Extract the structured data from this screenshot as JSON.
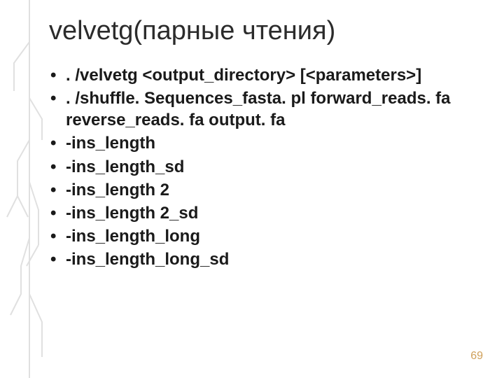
{
  "title": "velvetg(парные чтения)",
  "bullets": [
    ". /velvetg <output_directory> [<parameters>]",
    ". /shuffle. Sequences_fasta. pl forward_reads. fa reverse_reads. fa output. fa",
    "-ins_length",
    "-ins_length_sd",
    "-ins_length 2",
    "-ins_length 2_sd",
    "-ins_length_long",
    "-ins_length_long_sd"
  ],
  "page_number": "69"
}
